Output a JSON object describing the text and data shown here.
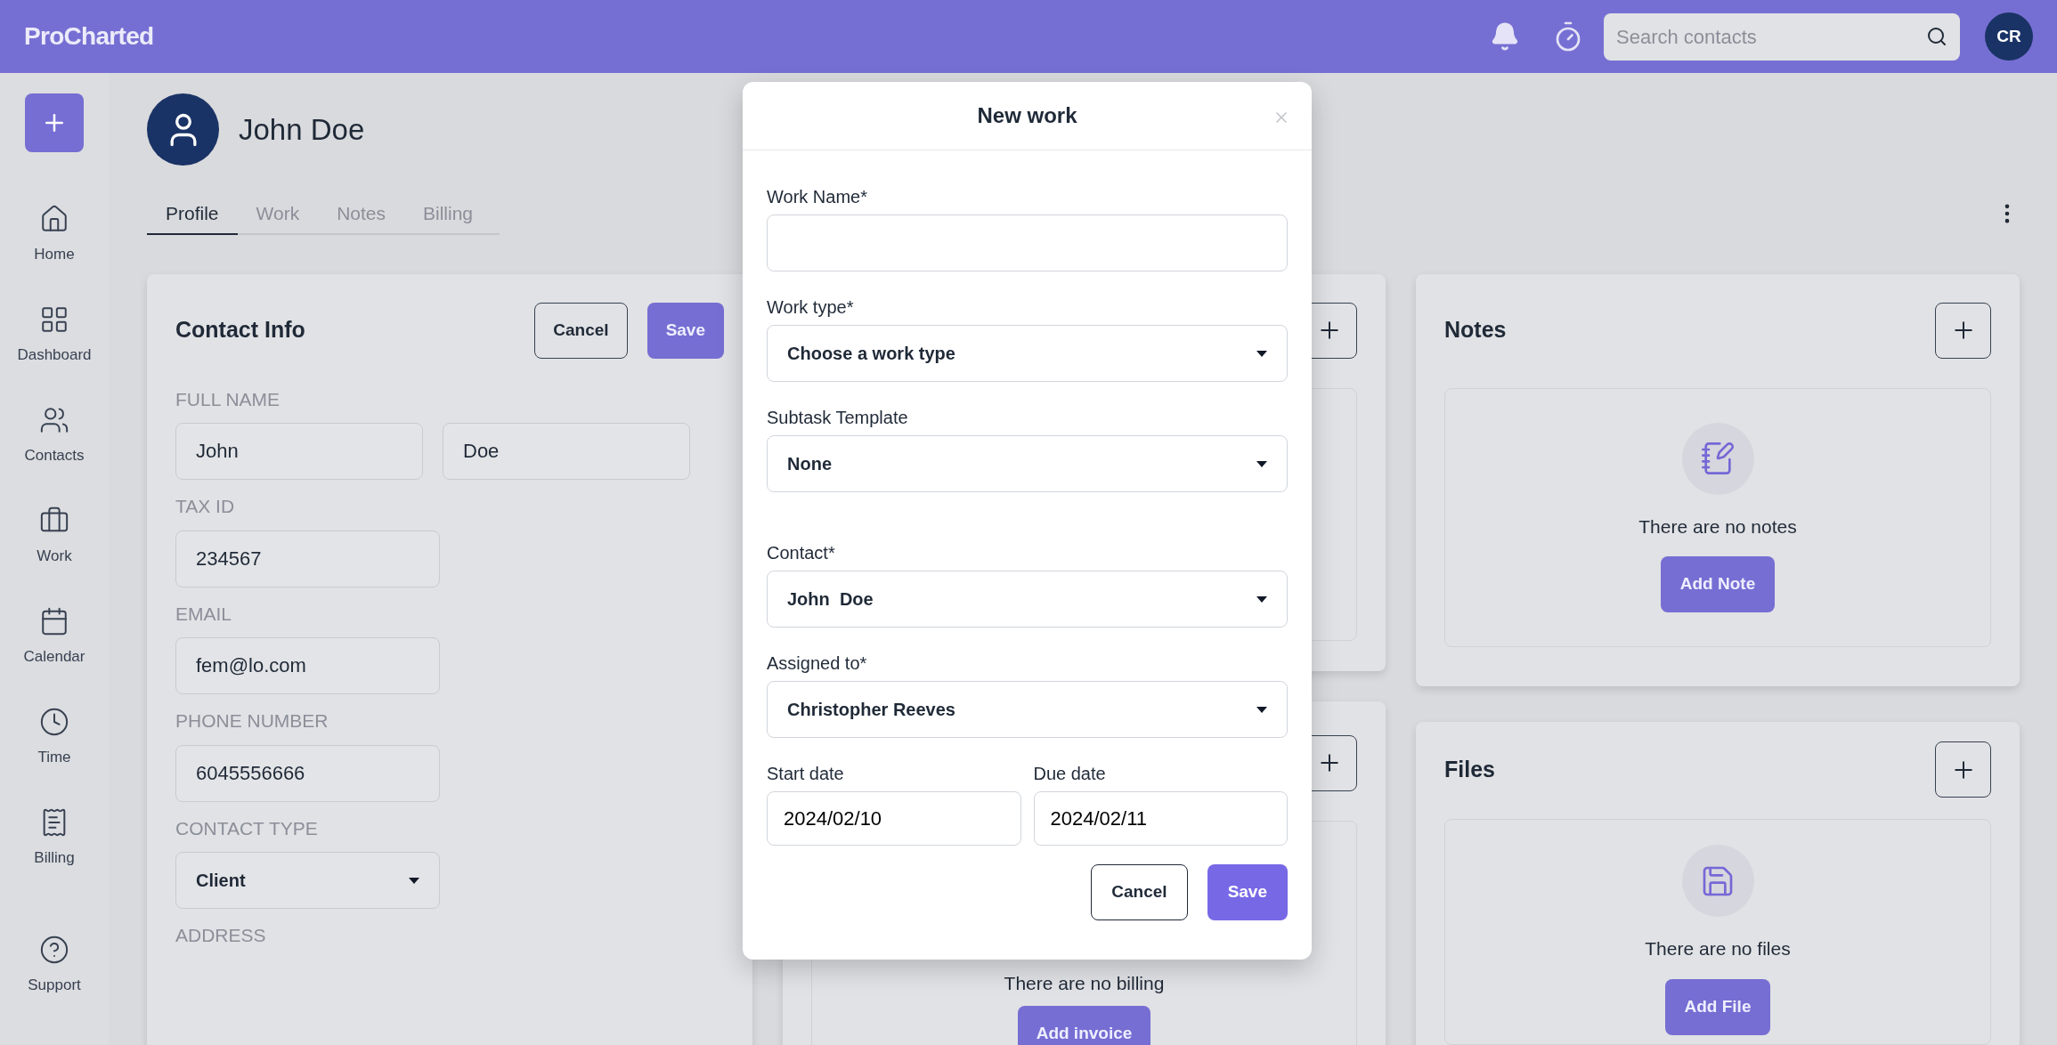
{
  "header": {
    "logo": "ProCharted",
    "search": {
      "placeholder": "Search contacts"
    },
    "avatar": "CR"
  },
  "sidebar": {
    "items": [
      {
        "label": "Home",
        "kind": "home"
      },
      {
        "label": "Dashboard",
        "kind": "dashboard"
      },
      {
        "label": "Contacts",
        "kind": "contacts"
      },
      {
        "label": "Work",
        "kind": "work"
      },
      {
        "label": "Calendar",
        "kind": "calendar"
      },
      {
        "label": "Time",
        "kind": "time"
      },
      {
        "label": "Billing",
        "kind": "billing"
      },
      {
        "label": "Support",
        "kind": "support"
      }
    ]
  },
  "contact": {
    "name": "John Doe"
  },
  "tabs": [
    {
      "label": "Profile",
      "selected": true
    },
    {
      "label": "Work",
      "selected": false
    },
    {
      "label": "Notes",
      "selected": false
    },
    {
      "label": "Billing",
      "selected": false
    }
  ],
  "contact_info": {
    "title": "Contact Info",
    "buttons": [
      "Cancel",
      "Save"
    ],
    "fields": [
      {
        "label": "FULL NAME",
        "kind": "pair",
        "values": [
          "John",
          "Doe"
        ]
      },
      {
        "label": "TAX ID",
        "kind": "text",
        "values": [
          "234567"
        ]
      },
      {
        "label": "EMAIL",
        "kind": "text",
        "values": [
          "fem@lo.com"
        ]
      },
      {
        "label": "PHONE NUMBER",
        "kind": "text",
        "values": [
          "6045556666"
        ]
      },
      {
        "label": "CONTACT TYPE",
        "kind": "select",
        "values": [
          "Client"
        ]
      },
      {
        "label": "ADDRESS",
        "kind": "label"
      }
    ]
  },
  "billing_card": {
    "empty_text": "There are no billing",
    "button": "Add invoice"
  },
  "notes": {
    "title": "Notes",
    "empty_text": "There are no notes",
    "button": "Add Note"
  },
  "files": {
    "title": "Files",
    "empty_text": "There are no files",
    "button": "Add File"
  },
  "modal": {
    "title": "New work",
    "fields": [
      {
        "label": "Work Name*",
        "kind": "input"
      },
      {
        "label": "Work type*",
        "kind": "select",
        "value": "Choose a work type"
      },
      {
        "label": "Subtask Template",
        "kind": "select",
        "value": "None"
      },
      {
        "label": "Contact*",
        "kind": "select",
        "value": "John  Doe"
      },
      {
        "label": "Assigned to*",
        "kind": "select",
        "value": "Christopher Reeves"
      }
    ],
    "dates": [
      {
        "label": "Start date",
        "value": "2024/02/10"
      },
      {
        "label": "Due date",
        "value": "2024/02/11"
      }
    ],
    "buttons": [
      "Cancel",
      "Save"
    ]
  }
}
